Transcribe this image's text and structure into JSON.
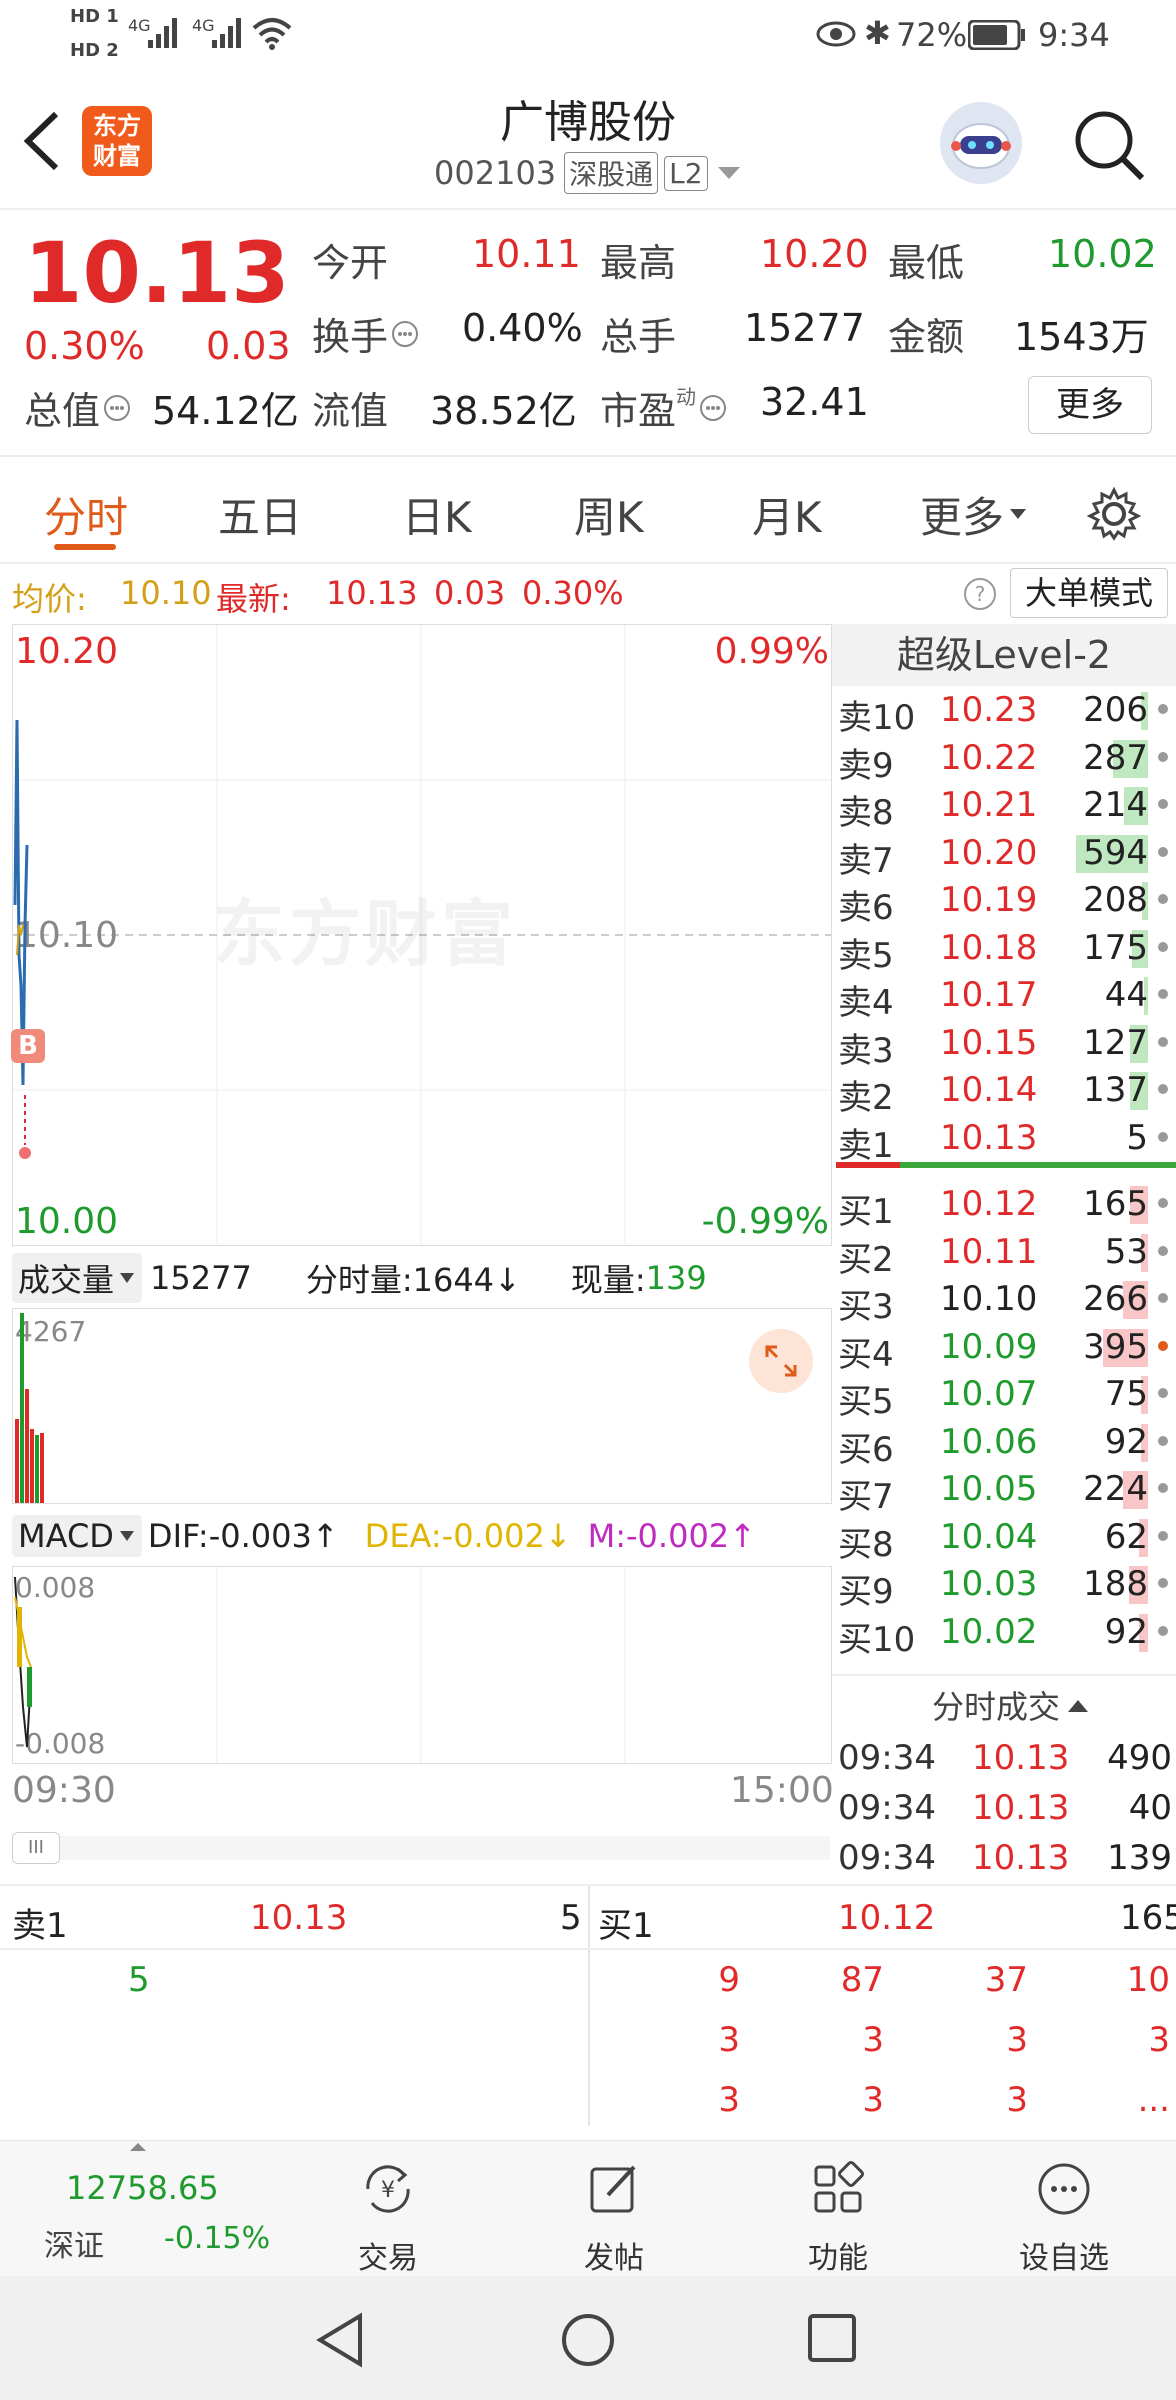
{
  "status_bar": {
    "hd1": "HD 1",
    "hd2": "HD 2",
    "net1": "4G",
    "net2": "4G",
    "battery": "72%",
    "time": "9:34"
  },
  "header": {
    "logo_line1": "东方",
    "logo_line2": "财富",
    "stock_name": "广博股份",
    "stock_code": "002103",
    "tag_connect": "深股通",
    "tag_level": "L2"
  },
  "quote": {
    "price": "10.13",
    "change_pct": "0.30%",
    "change": "0.03",
    "open_label": "今开",
    "open": "10.11",
    "high_label": "最高",
    "high": "10.20",
    "low_label": "最低",
    "low": "10.02",
    "turnover_label": "换手",
    "turnover": "0.40%",
    "volume_label": "总手",
    "volume": "15277",
    "amount_label": "金额",
    "amount": "1543万",
    "mktcap_label": "总值",
    "mktcap": "54.12亿",
    "float_label": "流值",
    "float": "38.52亿",
    "pe_label": "市盈",
    "pe_sup": "动",
    "pe": "32.41",
    "more_button": "更多"
  },
  "tabs": [
    "分时",
    "五日",
    "日K",
    "周K",
    "月K",
    "更多"
  ],
  "info_bar": {
    "avg_label": "均价:",
    "avg": "10.10",
    "latest_label": "最新:",
    "latest": "10.13",
    "chg": "0.03",
    "chg_pct": "0.30%",
    "big_order_button": "大单模式"
  },
  "chart": {
    "y_top": "10.20",
    "y_mid": "10.10",
    "y_bottom": "10.00",
    "pct_top": "0.99%",
    "pct_bottom": "-0.99%",
    "watermark": "东方财富",
    "b_marker": "B",
    "volume_selector": "成交量",
    "volume_total": "15277",
    "minute_volume": "分时量:1644↓",
    "now_volume_label": "现量:",
    "now_volume": "139",
    "vol_axis_max": "4267",
    "macd_selector": "MACD",
    "dif": "DIF:-0.003↑",
    "dea": "DEA:-0.002↓",
    "m": "M:-0.002↑",
    "macd_top": "0.008",
    "macd_bottom": "-0.008",
    "time_start": "09:30",
    "time_end": "15:00",
    "scroll_handle": "III",
    "colors": {
      "up": "#e02a2a",
      "down": "#1f9a2d",
      "price_line": "#2b6cb0"
    }
  },
  "order_book": {
    "title": "超级Level-2",
    "asks": [
      {
        "label": "卖10",
        "price": "10.23",
        "vol": "206",
        "bar": 0.1
      },
      {
        "label": "卖9",
        "price": "10.22",
        "vol": "287",
        "bar": 0.48
      },
      {
        "label": "卖8",
        "price": "10.21",
        "vol": "214",
        "bar": 0.34
      },
      {
        "label": "卖7",
        "price": "10.20",
        "vol": "594",
        "bar": 1.0
      },
      {
        "label": "卖6",
        "price": "10.19",
        "vol": "208",
        "bar": 0.08
      },
      {
        "label": "卖5",
        "price": "10.18",
        "vol": "175",
        "bar": 0.22
      },
      {
        "label": "卖4",
        "price": "10.17",
        "vol": "44",
        "bar": 0.05
      },
      {
        "label": "卖3",
        "price": "10.15",
        "vol": "127",
        "bar": 0.25
      },
      {
        "label": "卖2",
        "price": "10.14",
        "vol": "137",
        "bar": 0.25
      },
      {
        "label": "卖1",
        "price": "10.13",
        "vol": "5",
        "bar": 0.0
      }
    ],
    "bids": [
      {
        "label": "买1",
        "price": "10.12",
        "vol": "165",
        "bar": 0.25
      },
      {
        "label": "买2",
        "price": "10.11",
        "vol": "53",
        "bar": 0.1
      },
      {
        "label": "买3",
        "price": "10.10",
        "vol": "266",
        "bar": 0.35
      },
      {
        "label": "买4",
        "price": "10.09",
        "vol": "395",
        "bar": 0.62
      },
      {
        "label": "买5",
        "price": "10.07",
        "vol": "75",
        "bar": 0.1
      },
      {
        "label": "买6",
        "price": "10.06",
        "vol": "92",
        "bar": 0.1
      },
      {
        "label": "买7",
        "price": "10.05",
        "vol": "224",
        "bar": 0.35
      },
      {
        "label": "买8",
        "price": "10.04",
        "vol": "62",
        "bar": 0.12
      },
      {
        "label": "买9",
        "price": "10.03",
        "vol": "188",
        "bar": 0.26
      },
      {
        "label": "买10",
        "price": "10.02",
        "vol": "92",
        "bar": 0.12
      }
    ],
    "trades_title": "分时成交",
    "trades": [
      {
        "time": "09:34",
        "price": "10.13",
        "vol": "490",
        "dir": "up"
      },
      {
        "time": "09:34",
        "price": "10.13",
        "vol": "40",
        "dir": "up"
      },
      {
        "time": "09:34",
        "price": "10.13",
        "vol": "139",
        "dir": "down"
      }
    ]
  },
  "level2_table": {
    "sell_label": "卖1",
    "sell_price": "10.13",
    "sell_vol": "5",
    "sell_queue": [
      "5"
    ],
    "buy_label": "买1",
    "buy_price": "10.12",
    "buy_vol": "165",
    "buy_queue": [
      [
        "9",
        "87",
        "37",
        "10"
      ],
      [
        "3",
        "3",
        "3",
        "3"
      ],
      [
        "3",
        "3",
        "3",
        "..."
      ]
    ]
  },
  "bottom_nav": {
    "index_value": "12758.65",
    "index_name": "深证",
    "index_change": "-0.15%",
    "items": [
      "交易",
      "发帖",
      "功能",
      "设自选"
    ]
  }
}
